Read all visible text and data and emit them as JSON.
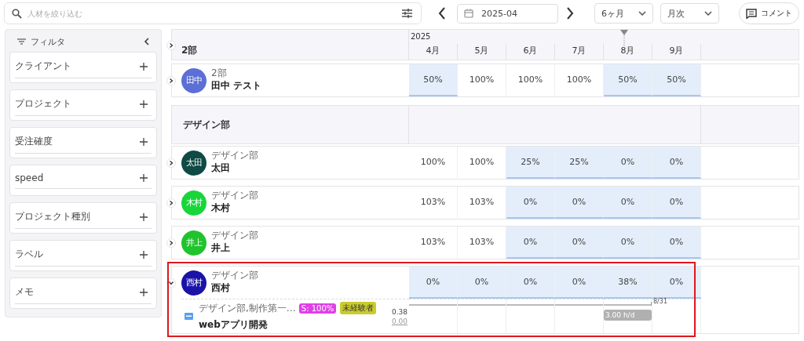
{
  "toolbar": {
    "search": {
      "placeholder": "人材を絞り込む"
    },
    "date": "2025-04",
    "period": "6ヶ月",
    "interval": "月次",
    "comment_button": "コメント"
  },
  "filter": {
    "title": "フィルタ",
    "items": [
      {
        "label": "クライアント"
      },
      {
        "label": "プロジェクト"
      },
      {
        "label": "受注確度"
      },
      {
        "label": "speed"
      },
      {
        "label": "プロジェクト種別"
      },
      {
        "label": "ラベル"
      },
      {
        "label": "メモ"
      }
    ]
  },
  "grid": {
    "year": "2025",
    "header_group": "2部",
    "header_expanded": false,
    "months": [
      {
        "label": "4月",
        "today": false
      },
      {
        "label": "5月",
        "today": false
      },
      {
        "label": "6月",
        "today": false
      },
      {
        "label": "7月",
        "today": false
      },
      {
        "label": "8月",
        "today": true
      },
      {
        "label": "9月",
        "today": false
      }
    ],
    "rows": [
      {
        "kind": "person",
        "dept": "2部",
        "name": "田中 テスト",
        "avatar": "田中",
        "color": "#5b6fd6",
        "expanded": false,
        "outlined": false,
        "cells": [
          {
            "value": "50%",
            "highlighted": true
          },
          {
            "value": "100%",
            "highlighted": false
          },
          {
            "value": "100%",
            "highlighted": false
          },
          {
            "value": "100%",
            "highlighted": false
          },
          {
            "value": "50%",
            "highlighted": true
          },
          {
            "value": "50%",
            "highlighted": true
          }
        ]
      },
      {
        "kind": "group",
        "name": "デザイン部"
      },
      {
        "kind": "person",
        "dept": "デザイン部",
        "name": "太田",
        "avatar": "太田",
        "color": "#0f4a45",
        "expanded": false,
        "outlined": false,
        "cells": [
          {
            "value": "100%",
            "highlighted": false
          },
          {
            "value": "100%",
            "highlighted": false
          },
          {
            "value": "25%",
            "highlighted": true
          },
          {
            "value": "25%",
            "highlighted": true
          },
          {
            "value": "0%",
            "highlighted": true
          },
          {
            "value": "0%",
            "highlighted": true
          }
        ]
      },
      {
        "kind": "person",
        "dept": "デザイン部",
        "name": "木村",
        "avatar": "木村",
        "color": "#18d63a",
        "expanded": false,
        "outlined": false,
        "cells": [
          {
            "value": "103%",
            "highlighted": false
          },
          {
            "value": "103%",
            "highlighted": false
          },
          {
            "value": "0%",
            "highlighted": true
          },
          {
            "value": "0%",
            "highlighted": true
          },
          {
            "value": "0%",
            "highlighted": true
          },
          {
            "value": "0%",
            "highlighted": true
          }
        ]
      },
      {
        "kind": "person",
        "dept": "デザイン部",
        "name": "井上",
        "avatar": "井上",
        "color": "#1fc42c",
        "expanded": false,
        "outlined": false,
        "cells": [
          {
            "value": "103%",
            "highlighted": false
          },
          {
            "value": "103%",
            "highlighted": false
          },
          {
            "value": "0%",
            "highlighted": true
          },
          {
            "value": "0%",
            "highlighted": true
          },
          {
            "value": "0%",
            "highlighted": true
          },
          {
            "value": "0%",
            "highlighted": true
          }
        ]
      },
      {
        "kind": "person",
        "dept": "デザイン部",
        "name": "西村",
        "avatar": "西村",
        "color": "#1a13a8",
        "expanded": true,
        "outlined": true,
        "cells": [
          {
            "value": "0%",
            "highlighted": true
          },
          {
            "value": "0%",
            "highlighted": true
          },
          {
            "value": "0%",
            "highlighted": true
          },
          {
            "value": "0%",
            "highlighted": true
          },
          {
            "value": "38%",
            "highlighted": true
          },
          {
            "value": "0%",
            "highlighted": true
          }
        ],
        "projects": [
          {
            "dept": "デザイン部,制作第一…",
            "tags": [
              {
                "label": "S: 100%",
                "color": "#e040e8"
              },
              {
                "label": "未経験者",
                "color": "#c9cb2e"
              }
            ],
            "name": "webアプリ開発",
            "value": "0.38",
            "sub_value": "0.00",
            "period_end": "8/31",
            "cells": [
              {
                "kind": "empty",
                "in_period": true
              },
              {
                "kind": "empty",
                "in_period": true
              },
              {
                "kind": "empty",
                "in_period": true
              },
              {
                "kind": "empty",
                "in_period": true
              },
              {
                "kind": "load",
                "label": "3.00 h/d",
                "in_period": true
              },
              {
                "kind": "empty",
                "in_period": false
              }
            ]
          }
        ]
      }
    ]
  }
}
